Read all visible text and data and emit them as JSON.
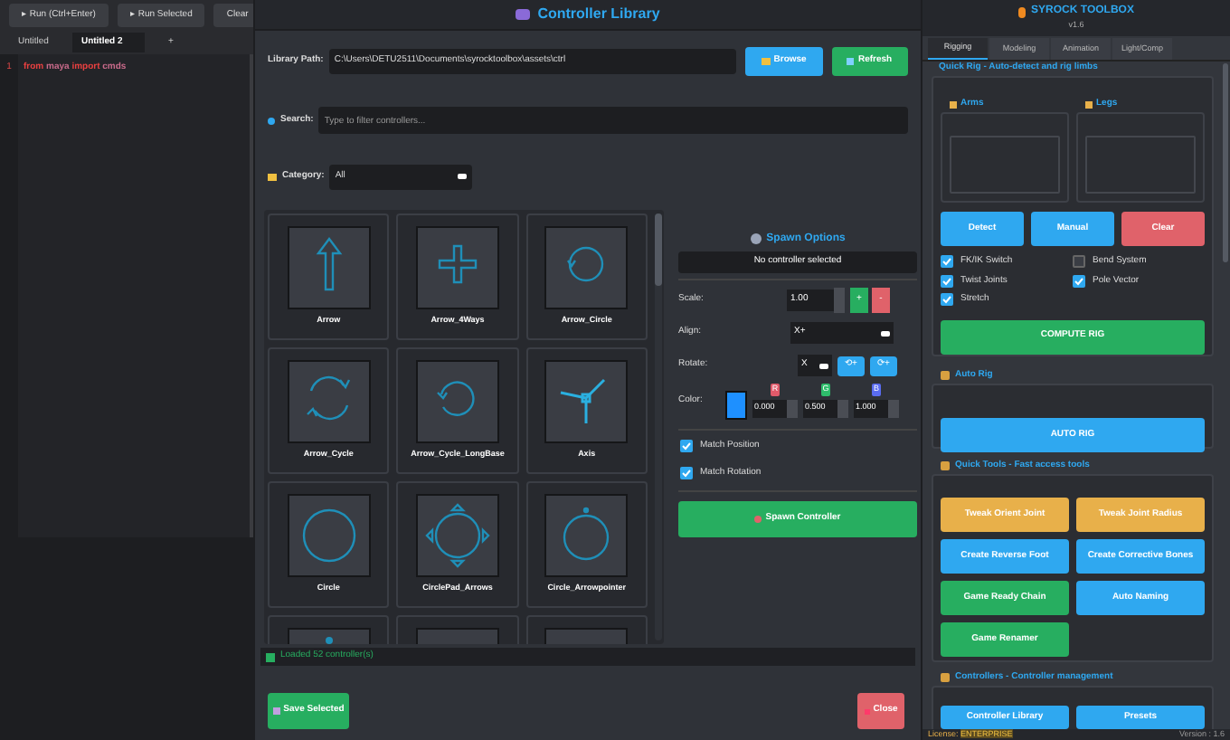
{
  "script_editor": {
    "toolbar": [
      "▸ Run (Ctrl+Enter)",
      "▸ Run Selected",
      "Clear"
    ],
    "tabs": [
      {
        "label": "Untitled",
        "selected": false
      },
      {
        "label": "Untitled 2",
        "selected": true
      },
      {
        "label": "+",
        "selected": false
      }
    ],
    "lines": [
      {
        "number": "1",
        "tokens": [
          {
            "text": "from",
            "kind": "keyword"
          },
          {
            "text": "maya",
            "kind": "name"
          },
          {
            "text": "import",
            "kind": "keyword"
          },
          {
            "text": "cmds",
            "kind": "name"
          }
        ]
      }
    ]
  },
  "library": {
    "title": "Controller Library",
    "path_label": "Library Path:",
    "path": "C:\\Users\\DETU2511\\Documents\\syrocktoolbox\\assets\\ctrl",
    "browse": "Browse",
    "refresh": "Refresh",
    "search_label": "Search:",
    "search_placeholder": "Type to filter controllers...",
    "category_label": "Category:",
    "category": "All",
    "controllers": [
      {
        "kind": "full",
        "label": "Arrow"
      },
      {
        "kind": "full",
        "label": "Arrow_4Ways"
      },
      {
        "kind": "full",
        "label": "Arrow_Circle"
      },
      {
        "kind": "full",
        "label": "Arrow_Cycle"
      },
      {
        "kind": "full",
        "label": "Arrow_Cycle_LongBase"
      },
      {
        "kind": "full",
        "label": "Axis"
      },
      {
        "kind": "full",
        "label": "Circle"
      },
      {
        "kind": "full",
        "label": "CirclePad_Arrows"
      },
      {
        "kind": "full",
        "label": "Circle_Arrowpointer"
      },
      {
        "kind": "partial"
      },
      {
        "kind": "partial"
      },
      {
        "kind": "partial"
      }
    ],
    "spawn": {
      "title": "Spawn Options",
      "selection": "No controller selected",
      "scale_label": "Scale:",
      "scale": "1.00",
      "plus": "+",
      "minus": "-",
      "align_label": "Align:",
      "align": "X+",
      "rotate_label": "Rotate:",
      "rotate_axis": "X",
      "rotate_buttons": [
        "⟲+",
        "⟳+"
      ],
      "color_label": "Color:",
      "channels": [
        {
          "label": "R",
          "value": "0.000",
          "color": "#e05a6a"
        },
        {
          "label": "G",
          "value": "0.500",
          "color": "#2ebd6b"
        },
        {
          "label": "B",
          "value": "1.000",
          "color": "#5a6cf0"
        }
      ],
      "options": [
        {
          "label": "Match Position",
          "checked": true
        },
        {
          "label": "Match Rotation",
          "checked": true
        }
      ],
      "spawn_button": "Spawn Controller"
    },
    "status": "Loaded 52 controller(s)",
    "save": "Save Selected",
    "close": "Close"
  },
  "toolbox": {
    "title": "SYROCK TOOLBOX",
    "version": "v1.6",
    "tabs": [
      {
        "label": "Rigging",
        "selected": true
      },
      {
        "label": "Modeling",
        "selected": false
      },
      {
        "label": "Animation",
        "selected": false
      },
      {
        "label": "Light/Comp",
        "selected": false
      }
    ],
    "quick_rig": {
      "title": "Quick Rig - Auto-detect and rig limbs",
      "arms": "Arms",
      "legs": "Legs",
      "buttons": [
        {
          "label": "Detect",
          "kind": "primary"
        },
        {
          "label": "Manual",
          "kind": "primary"
        },
        {
          "label": "Clear",
          "kind": "danger"
        }
      ],
      "options": [
        {
          "label": "FK/IK Switch",
          "checked": true
        },
        {
          "label": "Bend System",
          "checked": false
        },
        {
          "label": "Twist Joints",
          "checked": true
        },
        {
          "label": "Pole Vector",
          "checked": true
        },
        {
          "label": "Stretch",
          "checked": true
        }
      ],
      "compute": "COMPUTE RIG"
    },
    "auto_rig": {
      "title": "Auto Rig",
      "button": "AUTO RIG"
    },
    "quick_tools": {
      "title": "Quick Tools - Fast access tools",
      "buttons": [
        {
          "label": "Tweak Orient Joint",
          "kind": "warning"
        },
        {
          "label": "Tweak Joint Radius",
          "kind": "warning"
        },
        {
          "label": "Create Reverse Foot",
          "kind": "primary"
        },
        {
          "label": "Create Corrective Bones",
          "kind": "primary"
        },
        {
          "label": "Game Ready Chain",
          "kind": "success"
        },
        {
          "label": "Auto Naming",
          "kind": "primary"
        },
        {
          "label": "Game Renamer",
          "kind": "success"
        }
      ]
    },
    "controllers": {
      "title": "Controllers - Controller management",
      "buttons": [
        {
          "label": "Controller Library",
          "kind": "primary"
        },
        {
          "label": "Presets",
          "kind": "primary"
        }
      ]
    },
    "license_label": "License:",
    "license": "ENTERPRISE",
    "version_footer": "Version : 1.6"
  }
}
